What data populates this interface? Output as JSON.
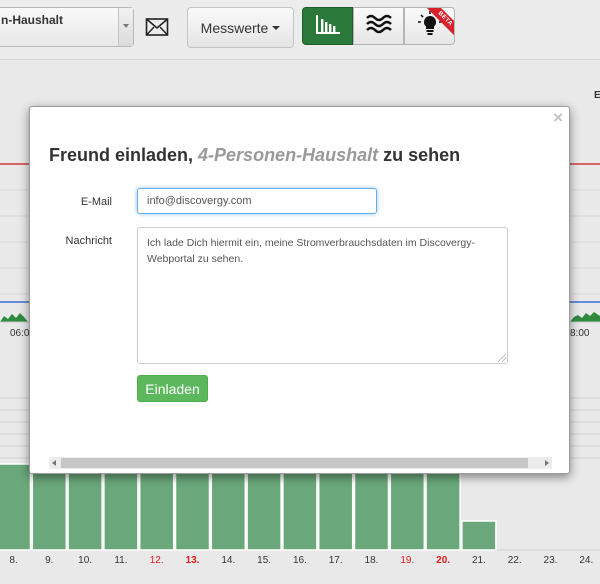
{
  "toolbar": {
    "household_select": "n-Haushalt",
    "mail_icon": "envelope-icon",
    "measure_label": "Messwerte",
    "views": [
      {
        "icon": "bar-chart-icon",
        "active": true
      },
      {
        "icon": "waves-icon",
        "active": false
      },
      {
        "icon": "lightbulb-icon",
        "active": false,
        "badge": "BETA"
      }
    ]
  },
  "background": {
    "right_edge_label": "E",
    "time_labels": [
      "06:0",
      "8:00"
    ],
    "day_chart": {
      "type": "bar",
      "categories": [
        "8.",
        "9.",
        "10.",
        "11.",
        "12.",
        "13.",
        "14.",
        "15.",
        "16.",
        "17.",
        "18.",
        "19.",
        "20.",
        "21.",
        "22.",
        "23.",
        "24."
      ],
      "weekend_categories": [
        "12.",
        "13.",
        "19.",
        "20."
      ],
      "bar_color": "#6aa77a",
      "weekend_color": "#e01b1b"
    }
  },
  "modal": {
    "close": "×",
    "title_prefix": "Freund einladen, ",
    "title_household": "4-Personen-Haushalt",
    "title_suffix": " zu sehen",
    "email_label": "E-Mail",
    "email_value": "info@discovergy.com",
    "message_label": "Nachricht",
    "message_value": "Ich lade Dich hiermit ein, meine Stromverbrauchsdaten im Discovergy-Webportal zu sehen.",
    "submit_label": "Einladen"
  },
  "colors": {
    "primary_green": "#2b7a3b",
    "button_green": "#5cb85c",
    "focus_blue": "#66afe9",
    "limit_red": "#d33b3b",
    "baseline_blue": "#3b6fd3"
  }
}
